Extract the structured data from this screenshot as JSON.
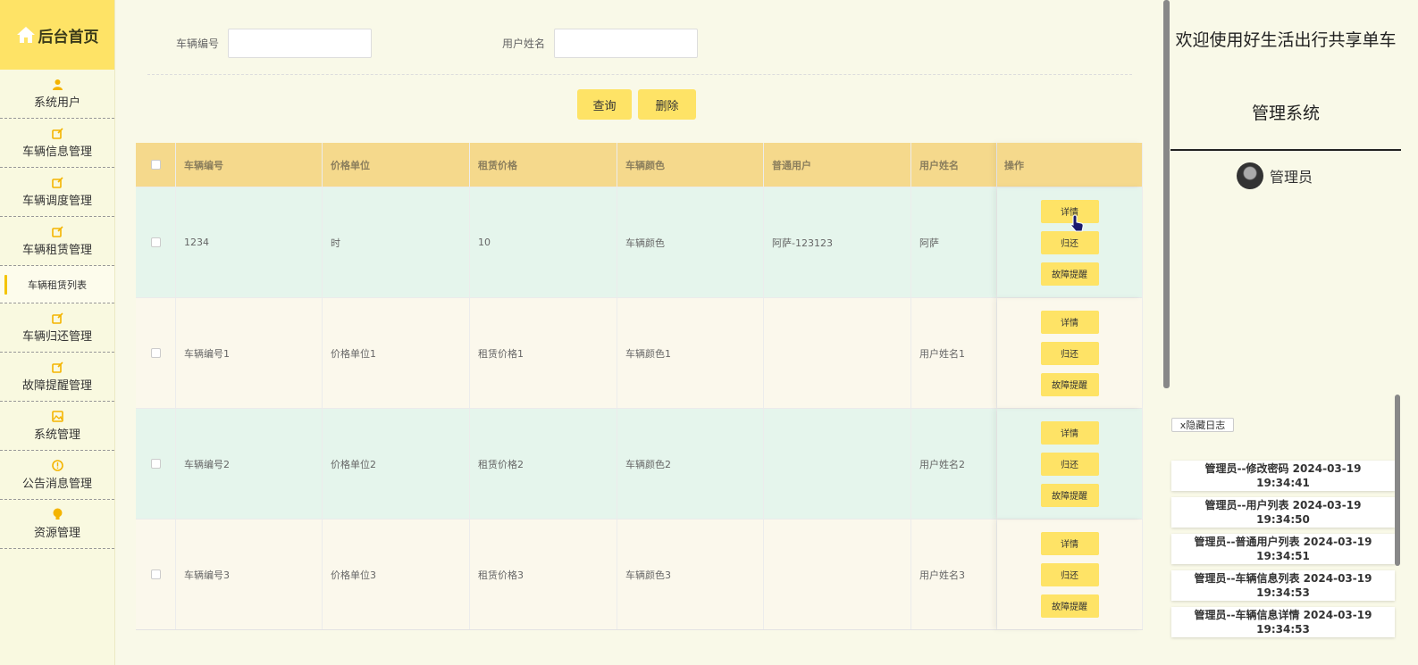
{
  "sidebar": {
    "logo": "后台首页",
    "items": [
      {
        "label": "系统用户",
        "icon": "user-icon"
      },
      {
        "label": "车辆信息管理",
        "icon": "edit-icon"
      },
      {
        "label": "车辆调度管理",
        "icon": "edit-icon"
      },
      {
        "label": "车辆租赁管理",
        "icon": "edit-icon"
      }
    ],
    "active_sub": "车辆租赁列表",
    "items2": [
      {
        "label": "车辆归还管理",
        "icon": "edit-icon"
      },
      {
        "label": "故障提醒管理",
        "icon": "edit-icon"
      },
      {
        "label": "系统管理",
        "icon": "image-icon"
      },
      {
        "label": "公告消息管理",
        "icon": "info-icon"
      },
      {
        "label": "资源管理",
        "icon": "bulb-icon"
      }
    ]
  },
  "search": {
    "vehicle_no_label": "车辆编号",
    "vehicle_no_value": "",
    "user_name_label": "用户姓名",
    "user_name_value": ""
  },
  "buttons": {
    "query": "查询",
    "delete": "删除"
  },
  "table": {
    "headers": [
      "车辆编号",
      "价格单位",
      "租赁价格",
      "车辆颜色",
      "普通用户",
      "用户姓名",
      "操作"
    ],
    "rows": [
      [
        "1234",
        "时",
        "10",
        "车辆颜色",
        "阿萨-123123",
        "阿萨"
      ],
      [
        "车辆编号1",
        "价格单位1",
        "租赁价格1",
        "车辆颜色1",
        "",
        "用户姓名1"
      ],
      [
        "车辆编号2",
        "价格单位2",
        "租赁价格2",
        "车辆颜色2",
        "",
        "用户姓名2"
      ],
      [
        "车辆编号3",
        "价格单位3",
        "租赁价格3",
        "车辆颜色3",
        "",
        "用户姓名3"
      ]
    ],
    "actions": {
      "detail": "详情",
      "return": "归还",
      "fault": "故障提醒"
    }
  },
  "right": {
    "welcome_line1": "欢迎使用好生活出行共享单车",
    "welcome_line2": "管理系统",
    "username": "管理员",
    "hide_log": "x隐藏日志",
    "logs": [
      "管理员--修改密码 2024-03-19 19:34:41",
      "管理员--用户列表 2024-03-19 19:34:50",
      "管理员--普通用户列表 2024-03-19 19:34:51",
      "管理员--车辆信息列表 2024-03-19 19:34:53",
      "管理员--车辆信息详情 2024-03-19 19:34:53"
    ]
  },
  "colors": {
    "accent": "#fee366",
    "header": "#f5d98c",
    "row_green": "#e5f5ec",
    "row_cream": "#fbf8ec"
  }
}
